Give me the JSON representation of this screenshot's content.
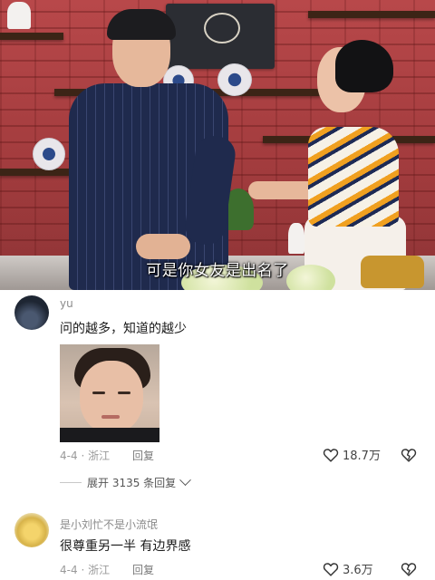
{
  "video": {
    "subtitle": "可是你女友是出名了"
  },
  "comments": [
    {
      "username": "yu",
      "text": "问的越多，知道的越少",
      "has_sticker": true,
      "date": "4-4",
      "location": "浙江",
      "reply_label": "回复",
      "likes": "18.7万",
      "expand_replies": "展开 3135 条回复"
    },
    {
      "username": "是小刘忙不是小流氓",
      "text": "很尊重另一半 有边界感",
      "date": "4-4",
      "location": "浙江",
      "reply_label": "回复",
      "likes": "3.6万"
    }
  ],
  "colors": {
    "subtitle_text": "#ffffff",
    "meta_text": "#9a9a9a",
    "username_text": "#8a8a8a"
  }
}
